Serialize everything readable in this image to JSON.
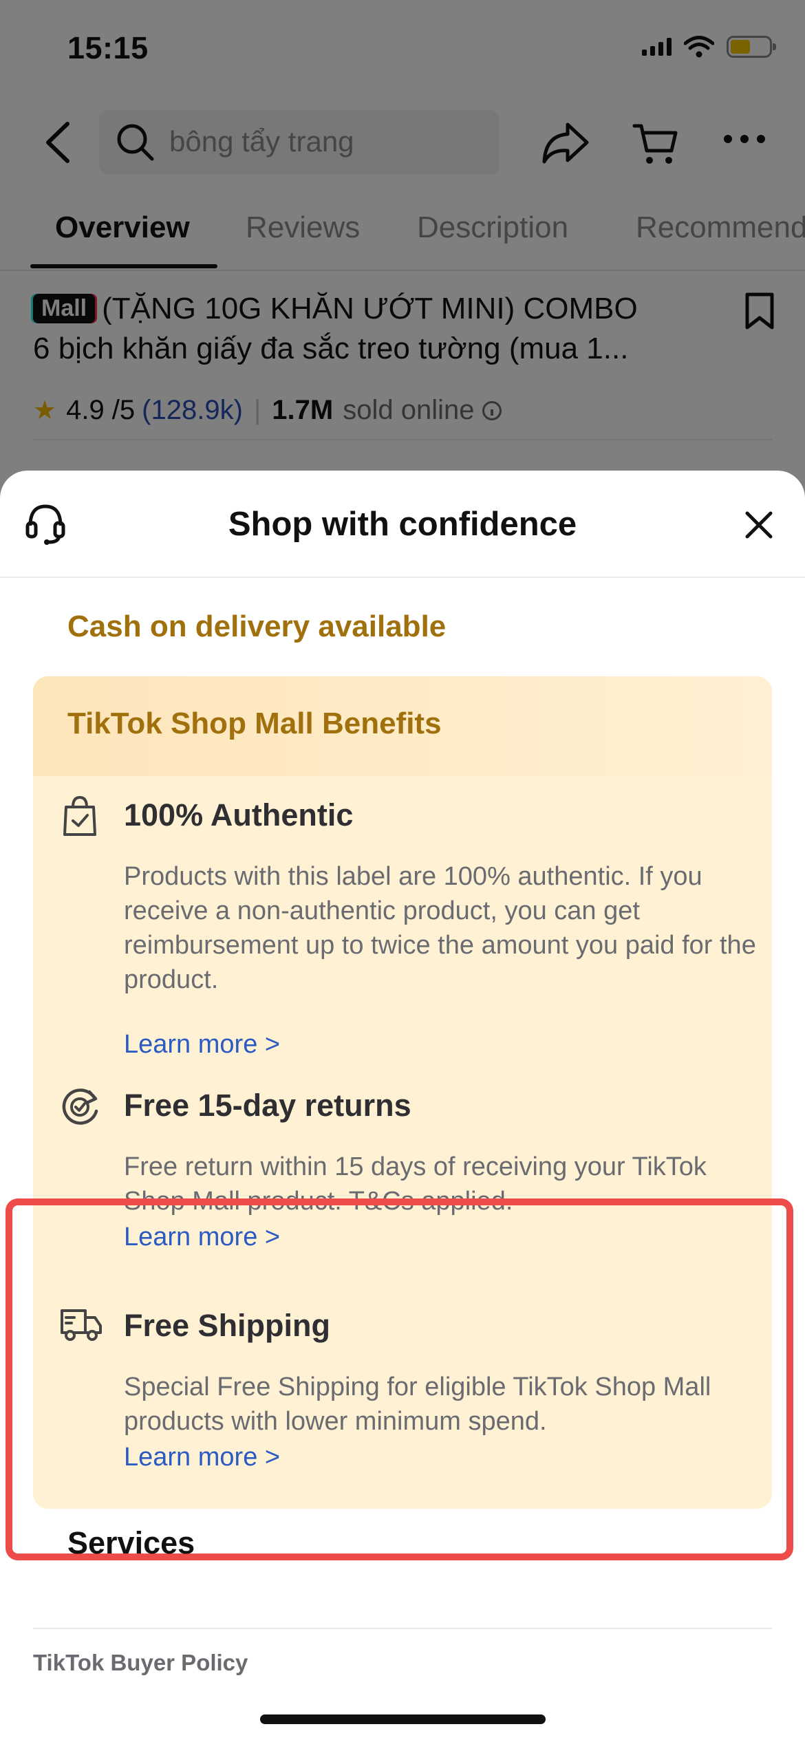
{
  "status_bar": {
    "time": "15:15"
  },
  "header": {
    "search_value": "bông tẩy trang"
  },
  "tabs": [
    {
      "label": "Overview"
    },
    {
      "label": "Reviews"
    },
    {
      "label": "Description"
    },
    {
      "label": "Recommended"
    }
  ],
  "product": {
    "badge": "Mall",
    "title_line1": "(TẶNG 10G KHĂN ƯỚT MINI) COMBO",
    "title_line2": "6 bịch khăn giấy đa sắc treo tường (mua 1...",
    "rating": "4.9 /5",
    "review_count": "(128.9k)",
    "sold_count": "1.7M",
    "sold_label": "sold online"
  },
  "sheet": {
    "title": "Shop with confidence",
    "cod": "Cash on delivery available",
    "benefits_title": "TikTok Shop Mall Benefits",
    "benefits": [
      {
        "icon": "shopping-bag-check-icon",
        "title": "100% Authentic",
        "description": "Products with this label are 100% authentic. If you receive a non-authentic product, you can get reimbursement up to twice the amount you paid for the product.",
        "link": "Learn more >"
      },
      {
        "icon": "return-check-icon",
        "title": "Free 15-day returns",
        "description": "Free return within 15 days of receiving your TikTok Shop Mall product. T&Cs applied.",
        "link": "Learn more >"
      },
      {
        "icon": "delivery-truck-icon",
        "title": "Free Shipping",
        "description": "Special Free Shipping for eligible TikTok Shop Mall products with lower minimum spend.",
        "link": "Learn more >"
      }
    ],
    "services_title": "Services",
    "policy": "TikTok Buyer Policy"
  },
  "colors": {
    "accent_gold": "#a0700d",
    "benefits_bg": "#fff1d3",
    "link_blue": "#2a5bc5",
    "highlight_red": "#ee4b4b"
  }
}
